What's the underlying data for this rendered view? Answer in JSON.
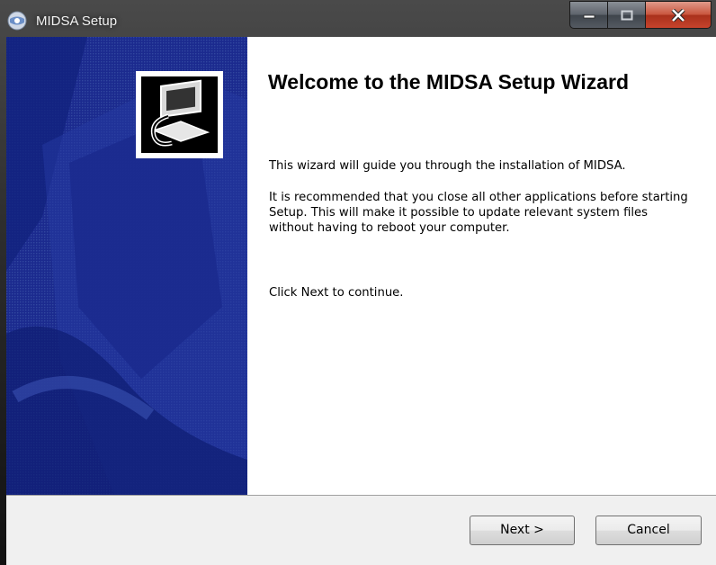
{
  "window": {
    "title": "MIDSA Setup",
    "app_icon": "installer-globe-icon",
    "controls": {
      "minimize": "minimize-icon",
      "maximize": "maximize-icon",
      "close": "close-icon"
    }
  },
  "banner": {
    "logo_icon": "computer-install-icon",
    "background_color": "#1a2b8f"
  },
  "content": {
    "heading": "Welcome to the MIDSA Setup Wizard",
    "paragraph1": "This wizard will guide you through the installation of MIDSA.",
    "paragraph2": "It is recommended that you close all other applications before starting Setup. This will make it possible to update relevant system files without having to reboot your computer.",
    "paragraph3": "Click Next to continue."
  },
  "footer": {
    "next_label": "Next >",
    "cancel_label": "Cancel"
  }
}
